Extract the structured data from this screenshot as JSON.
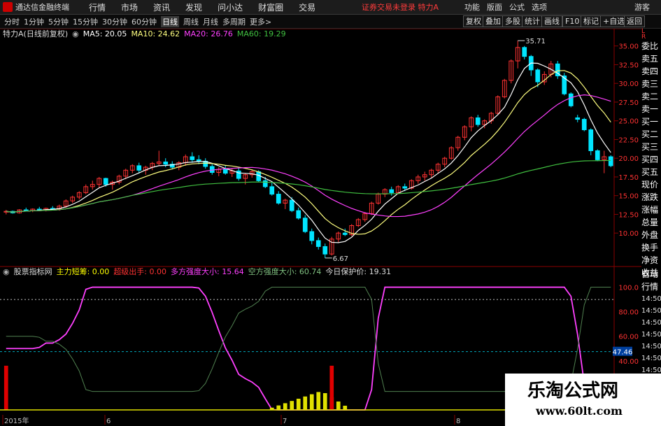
{
  "app_title": "通达信金融终端",
  "menu": [
    "行情",
    "市场",
    "资讯",
    "发现",
    "问小达",
    "财富圈",
    "交易"
  ],
  "notice": "证券交易未登录  特力A",
  "top_right": [
    "功能",
    "版面",
    "公式",
    "选项"
  ],
  "guest": "游客",
  "timeframes": [
    "分时",
    "1分钟",
    "5分钟",
    "15分钟",
    "30分钟",
    "60分钟",
    "日线",
    "周线",
    "月线",
    "多周期",
    "更多>"
  ],
  "active_timeframe": "日线",
  "right_buttons": [
    "复权",
    "叠加",
    "多股",
    "统计",
    "画线",
    "F10",
    "标记",
    "+自选",
    "返回"
  ],
  "info": {
    "stock": "特力A(日线前复权)",
    "ma5": "MA5: 20.05",
    "ma10": "MA10: 24.62",
    "ma20": "MA20: 26.76",
    "ma60": "MA60: 19.29"
  },
  "indicator": {
    "name": "股票指标网",
    "main_control": "主力短筹: 0.00",
    "super_out": "超级出手: 0.00",
    "bull_strength": "多方强度大小: 15.64",
    "bear_strength": "空方强度大小: 60.74",
    "today_protect": "今日保护价: 19.31"
  },
  "price_axis": [
    "35.00",
    "32.50",
    "30.00",
    "27.50",
    "25.00",
    "22.50",
    "20.00",
    "17.50",
    "15.00",
    "12.50",
    "10.00"
  ],
  "ind_axis": [
    "100.0",
    "80.00",
    "60.00",
    "40.00"
  ],
  "ind_axis_tag": "47.46",
  "high_label": "35.71",
  "low_label": "6.67",
  "date_labels": [
    "2015年",
    "6",
    "7",
    "8"
  ],
  "sidebar_top": [
    "L",
    "R",
    "委比",
    "卖五",
    "卖四",
    "卖三",
    "卖二",
    "卖一",
    "买一",
    "买二",
    "买三",
    "买四",
    "买五",
    "现价",
    "涨跌",
    "涨幅",
    "总量",
    "外盘",
    "换手",
    "净资",
    "收益"
  ],
  "sidebar_bottom": [
    "自动",
    "行情",
    "14:50",
    "14:50",
    "14:50",
    "14:50",
    "14:50",
    "14:50",
    "14:50",
    "14:50",
    "14:50",
    "14:50"
  ],
  "watermark": {
    "title": "乐淘公式网",
    "url": "www.60lt.com"
  },
  "colors": {
    "up": "#ff3232",
    "down": "#00e5ff",
    "ma5": "#ffffff",
    "ma10": "#ffff80",
    "ma20": "#ff40ff",
    "ma60": "#40c040"
  },
  "chart_data": {
    "type": "candlestick",
    "period": "日线",
    "ohlc": [
      [
        12.8,
        13.1,
        12.5,
        12.9
      ],
      [
        12.9,
        13.0,
        12.6,
        12.7
      ],
      [
        12.7,
        13.2,
        12.6,
        13.1
      ],
      [
        13.1,
        13.4,
        12.9,
        13.0
      ],
      [
        13.0,
        13.3,
        12.8,
        13.2
      ],
      [
        13.2,
        13.5,
        13.0,
        13.1
      ],
      [
        13.1,
        13.4,
        12.9,
        13.3
      ],
      [
        13.3,
        13.6,
        13.1,
        13.2
      ],
      [
        13.2,
        13.8,
        13.0,
        13.6
      ],
      [
        13.6,
        14.5,
        13.4,
        14.3
      ],
      [
        14.3,
        15.0,
        14.0,
        14.8
      ],
      [
        14.8,
        15.6,
        14.5,
        15.4
      ],
      [
        15.4,
        16.5,
        15.2,
        16.2
      ],
      [
        16.2,
        17.0,
        15.8,
        16.5
      ],
      [
        16.5,
        17.5,
        16.0,
        17.3
      ],
      [
        17.3,
        17.4,
        16.2,
        16.5
      ],
      [
        16.5,
        17.0,
        15.8,
        16.8
      ],
      [
        16.8,
        17.8,
        16.5,
        17.6
      ],
      [
        17.6,
        18.6,
        17.2,
        18.4
      ],
      [
        18.4,
        19.2,
        18.0,
        19.0
      ],
      [
        19.0,
        19.4,
        18.0,
        18.4
      ],
      [
        18.4,
        19.0,
        17.8,
        18.8
      ],
      [
        18.8,
        19.5,
        18.4,
        19.3
      ],
      [
        19.3,
        21.0,
        19.0,
        19.5
      ],
      [
        19.5,
        20.0,
        18.8,
        19.2
      ],
      [
        19.2,
        19.6,
        18.5,
        18.8
      ],
      [
        18.8,
        19.6,
        18.4,
        19.4
      ],
      [
        19.4,
        20.5,
        19.0,
        20.2
      ],
      [
        20.2,
        20.8,
        19.4,
        19.8
      ],
      [
        19.8,
        20.4,
        19.2,
        19.6
      ],
      [
        19.6,
        20.0,
        18.6,
        18.9
      ],
      [
        18.9,
        19.2,
        17.8,
        18.1
      ],
      [
        18.1,
        18.8,
        17.6,
        18.5
      ],
      [
        18.5,
        19.0,
        17.8,
        18.0
      ],
      [
        18.0,
        18.6,
        17.5,
        18.3
      ],
      [
        18.3,
        18.7,
        17.0,
        17.3
      ],
      [
        17.3,
        18.0,
        16.5,
        17.8
      ],
      [
        17.8,
        18.5,
        17.4,
        18.2
      ],
      [
        18.2,
        18.4,
        16.8,
        17.0
      ],
      [
        17.0,
        17.5,
        16.0,
        16.2
      ],
      [
        16.2,
        16.8,
        15.0,
        15.2
      ],
      [
        15.2,
        15.6,
        13.8,
        14.0
      ],
      [
        14.0,
        14.6,
        13.2,
        14.4
      ],
      [
        14.4,
        14.8,
        12.8,
        13.0
      ],
      [
        13.0,
        13.4,
        11.8,
        12.0
      ],
      [
        12.0,
        12.4,
        10.0,
        10.2
      ],
      [
        10.2,
        10.6,
        8.5,
        9.0
      ],
      [
        9.0,
        9.4,
        7.8,
        8.2
      ],
      [
        8.2,
        8.6,
        6.67,
        7.2
      ],
      [
        7.2,
        9.5,
        7.0,
        9.2
      ],
      [
        9.2,
        10.2,
        8.8,
        10.0
      ],
      [
        10.0,
        10.6,
        9.6,
        9.8
      ],
      [
        9.8,
        11.2,
        9.6,
        11.0
      ],
      [
        11.0,
        12.0,
        10.8,
        11.8
      ],
      [
        11.8,
        12.8,
        11.5,
        12.6
      ],
      [
        12.6,
        14.2,
        12.4,
        14.0
      ],
      [
        14.0,
        15.4,
        13.8,
        15.2
      ],
      [
        15.2,
        16.0,
        14.8,
        15.8
      ],
      [
        15.8,
        16.2,
        15.0,
        15.4
      ],
      [
        15.4,
        16.4,
        15.2,
        16.2
      ],
      [
        16.2,
        16.6,
        15.6,
        16.0
      ],
      [
        16.0,
        17.2,
        15.8,
        17.0
      ],
      [
        17.0,
        17.8,
        16.6,
        17.5
      ],
      [
        17.5,
        18.2,
        17.0,
        17.8
      ],
      [
        17.8,
        18.6,
        17.4,
        18.4
      ],
      [
        18.4,
        19.4,
        18.0,
        19.2
      ],
      [
        19.2,
        20.2,
        18.8,
        20.0
      ],
      [
        20.0,
        21.6,
        19.8,
        21.4
      ],
      [
        21.4,
        23.0,
        21.0,
        22.8
      ],
      [
        22.8,
        24.4,
        22.4,
        24.2
      ],
      [
        24.2,
        25.6,
        23.6,
        25.4
      ],
      [
        25.4,
        25.8,
        24.2,
        24.5
      ],
      [
        24.5,
        25.2,
        24.0,
        25.0
      ],
      [
        25.0,
        26.2,
        24.6,
        26.0
      ],
      [
        26.0,
        28.4,
        25.8,
        28.2
      ],
      [
        28.2,
        30.6,
        28.0,
        30.4
      ],
      [
        30.4,
        33.2,
        30.0,
        33.0
      ],
      [
        33.0,
        35.71,
        32.0,
        34.8
      ],
      [
        34.8,
        35.0,
        33.2,
        33.6
      ],
      [
        33.6,
        33.8,
        31.0,
        31.8
      ],
      [
        31.8,
        32.0,
        29.5,
        30.2
      ],
      [
        30.2,
        31.6,
        29.8,
        31.2
      ],
      [
        31.2,
        33.0,
        30.8,
        32.6
      ],
      [
        32.6,
        33.0,
        30.6,
        31.0
      ],
      [
        31.0,
        31.4,
        28.4,
        28.6
      ],
      [
        28.6,
        28.8,
        26.8,
        27.0
      ],
      [
        25.4,
        25.8,
        24.8,
        25.2
      ],
      [
        25.2,
        25.4,
        23.6,
        23.8
      ],
      [
        23.8,
        24.0,
        20.4,
        21.0
      ],
      [
        21.0,
        21.2,
        19.6,
        19.8
      ],
      [
        19.8,
        21.0,
        18.0,
        20.2
      ],
      [
        20.2,
        20.4,
        18.8,
        19.0
      ]
    ],
    "ylim": [
      6,
      36
    ],
    "y_ticks": [
      10,
      12.5,
      15,
      17.5,
      20,
      22.5,
      25,
      27.5,
      30,
      32.5,
      35
    ]
  }
}
